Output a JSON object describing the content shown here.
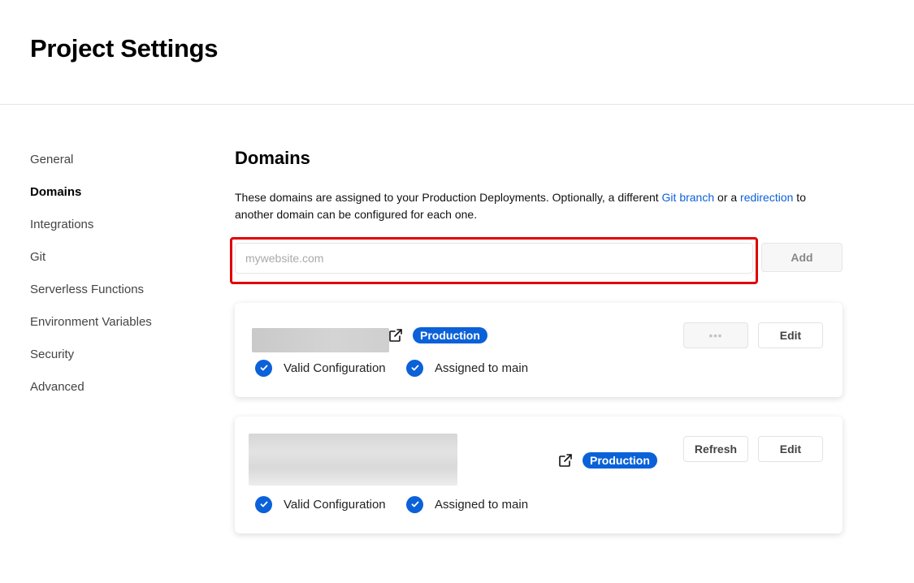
{
  "header": {
    "title": "Project Settings"
  },
  "sidebar": {
    "items": [
      {
        "label": "General",
        "active": false
      },
      {
        "label": "Domains",
        "active": true
      },
      {
        "label": "Integrations",
        "active": false
      },
      {
        "label": "Git",
        "active": false
      },
      {
        "label": "Serverless Functions",
        "active": false
      },
      {
        "label": "Environment Variables",
        "active": false
      },
      {
        "label": "Security",
        "active": false
      },
      {
        "label": "Advanced",
        "active": false
      }
    ]
  },
  "domains": {
    "title": "Domains",
    "description_pre": "These domains are assigned to your Production Deployments. Optionally, a different ",
    "git_branch_link": "Git branch",
    "description_mid": " or a ",
    "redirection_link": "redirection",
    "description_post": " to another domain can be configured for each one.",
    "input": {
      "placeholder": "mywebsite.com",
      "value": ""
    },
    "add_label": "Add",
    "cards": [
      {
        "badge": "Production",
        "more_label": "•••",
        "edit_label": "Edit",
        "status_valid": "Valid Configuration",
        "status_assigned": "Assigned to main"
      },
      {
        "badge": "Production",
        "refresh_label": "Refresh",
        "edit_label": "Edit",
        "status_valid": "Valid Configuration",
        "status_assigned": "Assigned to main"
      }
    ]
  },
  "colors": {
    "accent": "#0b61d8",
    "highlight": "#e00000",
    "text": "#111111",
    "muted": "#444444"
  },
  "icons": {
    "external_link": "external-link-icon",
    "check": "check-circle-icon"
  }
}
